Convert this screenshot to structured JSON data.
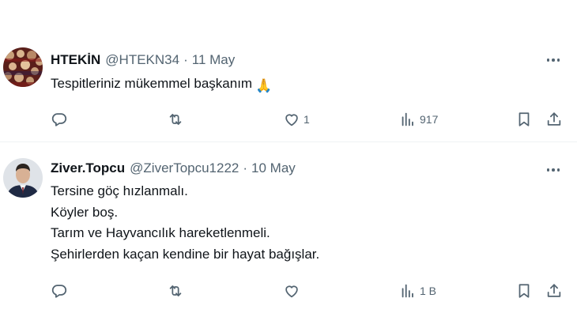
{
  "tweets": [
    {
      "name": "HTEKİN",
      "handle": "@HTEKN34",
      "separator": "·",
      "date": "11 May",
      "text_lines": [
        "Tespitleriniz mükemmel başkanım"
      ],
      "emoji": "🙏",
      "replies": "",
      "retweets": "",
      "likes": "1",
      "views": "917"
    },
    {
      "name": "Ziver.Topcu",
      "handle": "@ZiverTopcu1222",
      "separator": "·",
      "date": "10 May",
      "text_lines": [
        "Tersine göç hızlanmalı.",
        "Köyler boş.",
        "Tarım ve Hayvancılık hareketlenmeli.",
        "Şehirlerden kaçan kendine bir hayat bağışlar."
      ],
      "replies": "",
      "retweets": "",
      "likes": "",
      "views": "1 B"
    }
  ],
  "icons": {
    "reply": "reply-icon",
    "retweet": "retweet-icon",
    "like": "heart-icon",
    "views": "views-icon",
    "bookmark": "bookmark-icon",
    "share": "share-icon",
    "more": "more-icon"
  },
  "colors": {
    "text": "#0f1419",
    "secondary": "#536471",
    "divider": "#eff3f4"
  }
}
